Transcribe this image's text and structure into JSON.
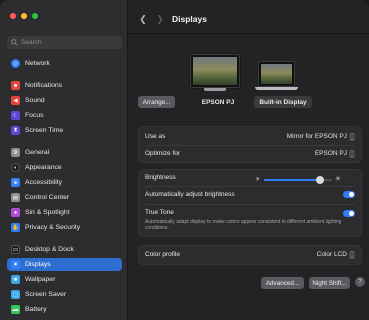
{
  "search": {
    "placeholder": "Search"
  },
  "sidebar": {
    "items": [
      {
        "label": "Network",
        "color": "#2f7ff6",
        "glyph": "◎"
      },
      {
        "label": "Notifications",
        "color": "#e5453b",
        "glyph": "■"
      },
      {
        "label": "Sound",
        "color": "#e5453b",
        "glyph": "◀"
      },
      {
        "label": "Focus",
        "color": "#5a48d6",
        "glyph": "☾"
      },
      {
        "label": "Screen Time",
        "color": "#5a48d6",
        "glyph": "⧗"
      },
      {
        "label": "General",
        "color": "#8e8e93",
        "glyph": "⚙"
      },
      {
        "label": "Appearance",
        "color": "#1c1c1e",
        "glyph": "◐"
      },
      {
        "label": "Accessibility",
        "color": "#2f7ff6",
        "glyph": "⊕"
      },
      {
        "label": "Control Center",
        "color": "#8e8e93",
        "glyph": "▤"
      },
      {
        "label": "Siri & Spotlight",
        "color": "#b04bd6",
        "glyph": "●"
      },
      {
        "label": "Privacy & Security",
        "color": "#2f7ff6",
        "glyph": "✋"
      },
      {
        "label": "Desktop & Dock",
        "color": "#1c1c1e",
        "glyph": "▭"
      },
      {
        "label": "Displays",
        "color": "#2f7ff6",
        "glyph": "✷"
      },
      {
        "label": "Wallpaper",
        "color": "#3aa7e8",
        "glyph": "❀"
      },
      {
        "label": "Screen Saver",
        "color": "#3aa7e8",
        "glyph": "▢"
      },
      {
        "label": "Battery",
        "color": "#34c759",
        "glyph": "▬"
      }
    ]
  },
  "header": {
    "title": "Displays"
  },
  "displays": {
    "arrange_label": "Arrange...",
    "pj_label": "EPSON PJ",
    "builtin_label": "Built-in Display"
  },
  "settings": {
    "use_as_label": "Use as",
    "use_as_value": "Mirror for EPSON PJ",
    "optimize_label": "Optimize for",
    "optimize_value": "EPSON PJ",
    "brightness_label": "Brightness",
    "brightness_level": 0.82,
    "auto_brightness_label": "Automatically adjust brightness",
    "true_tone_label": "True Tone",
    "true_tone_desc": "Automatically adapt display to make colors appear consistent in different ambient lighting conditions.",
    "color_profile_label": "Color profile",
    "color_profile_value": "Color LCD"
  },
  "footer": {
    "advanced_label": "Advanced...",
    "night_shift_label": "Night Shift...",
    "help_label": "?"
  }
}
